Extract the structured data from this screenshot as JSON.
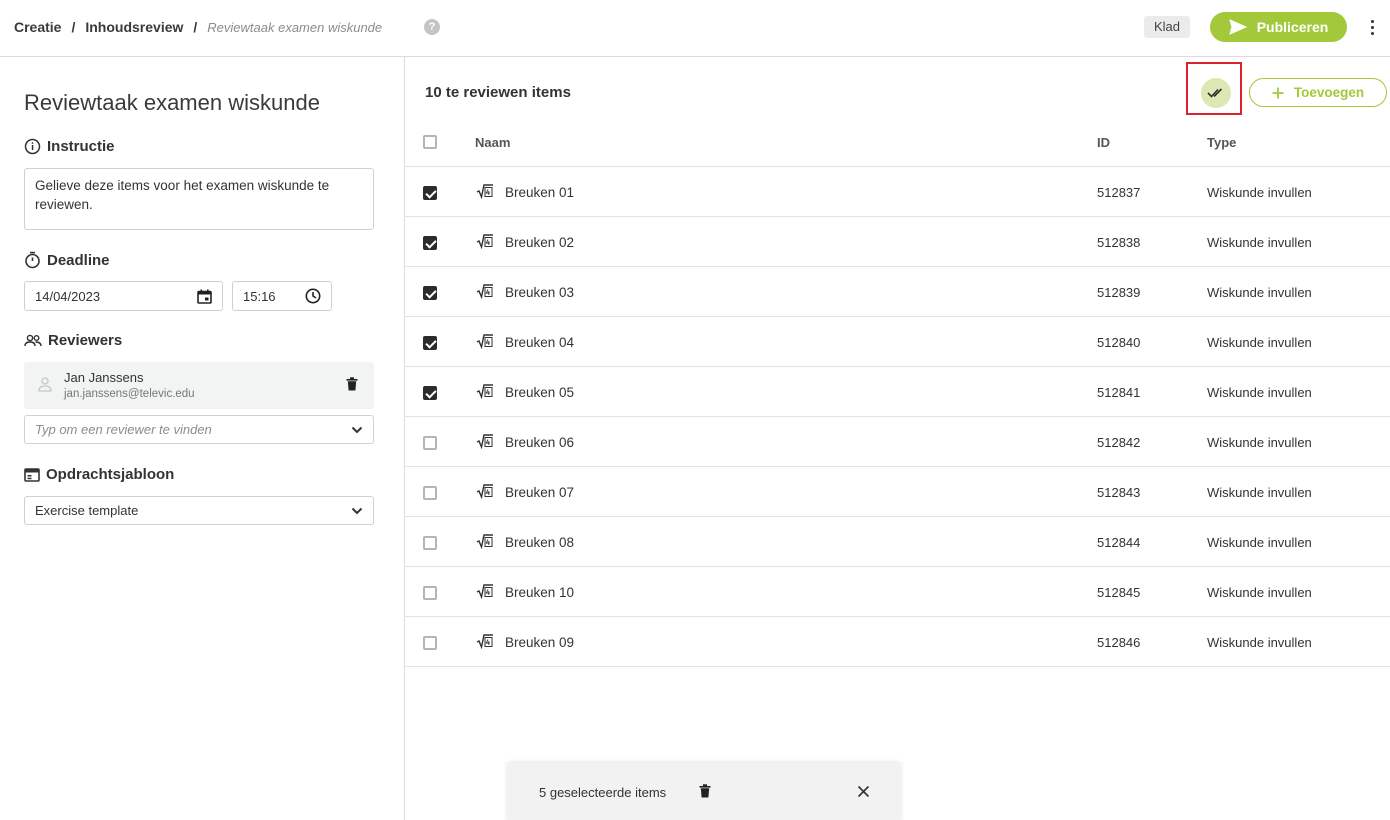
{
  "header": {
    "breadcrumb": [
      "Creatie",
      "Inhoudsreview"
    ],
    "breadcrumb_separator": "/",
    "current": "Reviewtaak examen wiskunde",
    "help_icon": "?",
    "status": "Klad",
    "publish_label": "Publiceren"
  },
  "left": {
    "title": "Reviewtaak examen wiskunde",
    "instruction_label": "Instructie",
    "instruction_text": "Gelieve deze items voor het examen wiskunde te reviewen.",
    "deadline_label": "Deadline",
    "deadline_date": "14/04/2023",
    "deadline_time": "15:16",
    "reviewers_label": "Reviewers",
    "reviewer": {
      "name": "Jan Janssens",
      "email": "jan.janssens@televic.edu"
    },
    "reviewer_search_placeholder": "Typ om een reviewer te vinden",
    "template_label": "Opdrachtsjabloon",
    "template_value": "Exercise template"
  },
  "right": {
    "items_title": "10 te reviewen items",
    "add_label": "Toevoegen",
    "columns": {
      "name": "Naam",
      "id": "ID",
      "type": "Type"
    },
    "rows": [
      {
        "name": "Breuken 01",
        "id": "512837",
        "type": "Wiskunde invullen",
        "checked": true
      },
      {
        "name": "Breuken 02",
        "id": "512838",
        "type": "Wiskunde invullen",
        "checked": true
      },
      {
        "name": "Breuken 03",
        "id": "512839",
        "type": "Wiskunde invullen",
        "checked": true
      },
      {
        "name": "Breuken 04",
        "id": "512840",
        "type": "Wiskunde invullen",
        "checked": true
      },
      {
        "name": "Breuken 05",
        "id": "512841",
        "type": "Wiskunde invullen",
        "checked": true
      },
      {
        "name": "Breuken 06",
        "id": "512842",
        "type": "Wiskunde invullen",
        "checked": false
      },
      {
        "name": "Breuken 07",
        "id": "512843",
        "type": "Wiskunde invullen",
        "checked": false
      },
      {
        "name": "Breuken 08",
        "id": "512844",
        "type": "Wiskunde invullen",
        "checked": false
      },
      {
        "name": "Breuken 10",
        "id": "512845",
        "type": "Wiskunde invullen",
        "checked": false
      },
      {
        "name": "Breuken 09",
        "id": "512846",
        "type": "Wiskunde invullen",
        "checked": false
      }
    ],
    "selection_text": "5 geselecteerde items"
  },
  "colors": {
    "accent": "#a3c93a",
    "accent_light": "#dbe8b4",
    "highlight": "#d9232d"
  },
  "icons": {
    "help": "question-circle-icon",
    "publish": "send-icon",
    "more": "more-vertical-icon",
    "instruction": "info-icon",
    "deadline": "stopwatch-icon",
    "reviewers": "people-icon",
    "template": "template-icon",
    "calendar": "calendar-icon",
    "clock": "clock-icon",
    "delete": "trash-icon",
    "check_all": "double-check-icon",
    "add": "plus-icon",
    "item": "math-root-icon",
    "close": "close-icon"
  }
}
